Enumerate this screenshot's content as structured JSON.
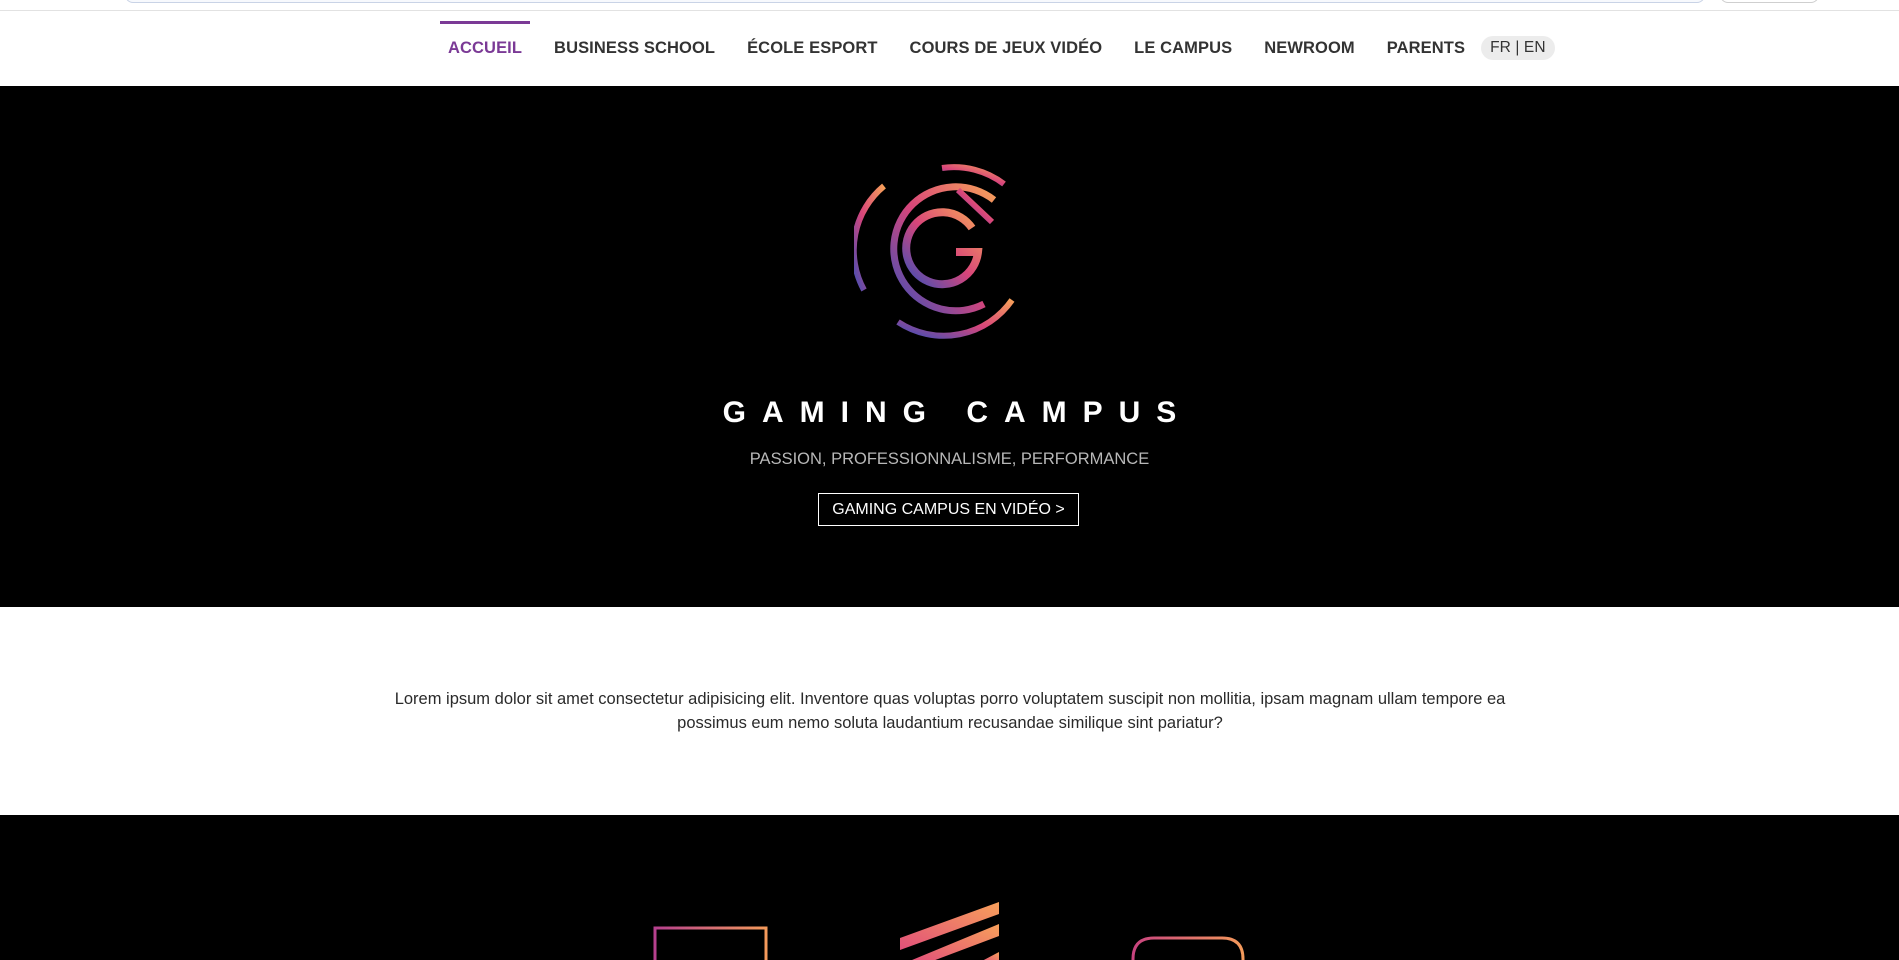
{
  "nav": {
    "items": [
      {
        "label": "ACCUEIL",
        "active": true
      },
      {
        "label": "BUSINESS SCHOOL",
        "active": false
      },
      {
        "label": "ÉCOLE ESPORT",
        "active": false
      },
      {
        "label": "COURS DE JEUX VIDÉO",
        "active": false
      },
      {
        "label": "LE CAMPUS",
        "active": false
      },
      {
        "label": "NEWROOM",
        "active": false
      },
      {
        "label": "PARENTS",
        "active": false
      }
    ],
    "language_switch": "FR | EN"
  },
  "hero": {
    "logo_icon": "gaming-campus-logo-icon",
    "brand_name": "GAMING CAMPUS",
    "tagline": "PASSION, PROFESSIONNALISME, PERFORMANCE",
    "video_button_label": "GAMING CAMPUS EN VIDÉO >"
  },
  "intro": {
    "text": "Lorem ipsum dolor sit amet consectetur adipisicing elit. Inventore quas voluptas porro voluptatem suscipit non mollitia, ipsam magnam ullam tempore ea possimus eum nemo soluta laudantium recusandae similique sint pariatur?"
  },
  "colors": {
    "accent": "#7b3a96",
    "gradient_start": "#f49a5b",
    "gradient_mid": "#d8457a",
    "gradient_end": "#3c4fb8"
  },
  "features": {
    "icons": [
      "square-outline-icon",
      "stripes-icon",
      "rounded-box-icon"
    ]
  }
}
